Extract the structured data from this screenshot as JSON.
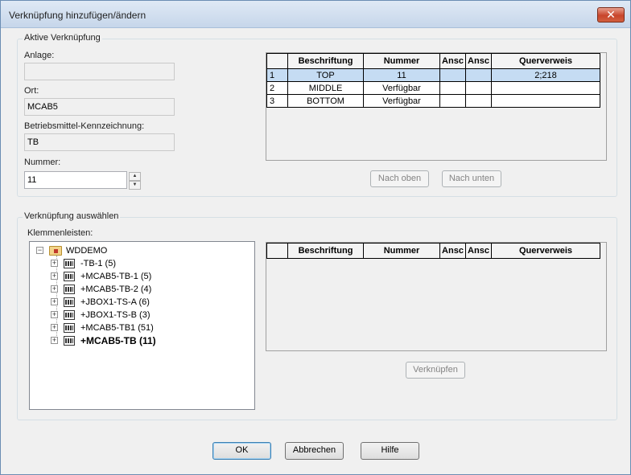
{
  "window": {
    "title": "Verknüpfung hinzufügen/ändern",
    "close_glyph": "✕"
  },
  "active": {
    "legend": "Aktive Verknüpfung",
    "anlage_label": "Anlage:",
    "anlage_value": "",
    "ort_label": "Ort:",
    "ort_value": "MCAB5",
    "bmk_label": "Betriebsmittel-Kennzeichnung:",
    "bmk_value": "TB",
    "nummer_label": "Nummer:",
    "nummer_value": "11",
    "table": {
      "headers": [
        "",
        "Beschriftung",
        "Nummer",
        "Ansc",
        "Ansc",
        "Querverweis"
      ],
      "rows": [
        {
          "idx": "1",
          "beschriftung": "TOP",
          "nummer": "11",
          "a1": "",
          "a2": "",
          "querverweis": "2;218"
        },
        {
          "idx": "2",
          "beschriftung": "MIDDLE",
          "nummer": "Verfügbar",
          "a1": "",
          "a2": "",
          "querverweis": ""
        },
        {
          "idx": "3",
          "beschriftung": "BOTTOM",
          "nummer": "Verfügbar",
          "a1": "",
          "a2": "",
          "querverweis": ""
        }
      ]
    },
    "up_button": "Nach oben",
    "down_button": "Nach unten"
  },
  "select": {
    "legend": "Verknüpfung auswählen",
    "klemmen_label": "Klemmenleisten:",
    "tree": {
      "root": "WDDEMO",
      "items": [
        {
          "label": "-TB-1 (5)",
          "bold": false
        },
        {
          "label": "+MCAB5-TB-1 (5)",
          "bold": false
        },
        {
          "label": "+MCAB5-TB-2 (4)",
          "bold": false
        },
        {
          "label": "+JBOX1-TS-A (6)",
          "bold": false
        },
        {
          "label": "+JBOX1-TS-B (3)",
          "bold": false
        },
        {
          "label": "+MCAB5-TB1 (51)",
          "bold": false
        },
        {
          "label": "+MCAB5-TB (11)",
          "bold": true
        }
      ]
    },
    "table": {
      "headers": [
        "",
        "Beschriftung",
        "Nummer",
        "Ansc",
        "Ansc",
        "Querverweis"
      ]
    },
    "link_button": "Verknüpfen"
  },
  "footer": {
    "ok": "OK",
    "cancel": "Abbrechen",
    "help": "Hilfe"
  },
  "icons": {
    "folder": "folder-icon",
    "terminal": "terminal-strip-icon",
    "expand": "+",
    "collapse": "−",
    "spin_up": "▲",
    "spin_down": "▼"
  }
}
